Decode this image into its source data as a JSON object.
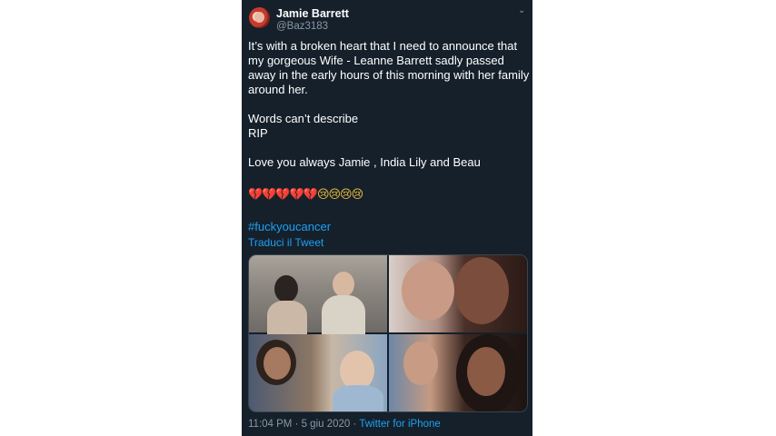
{
  "author": {
    "name": "Jamie Barrett",
    "handle": "@Baz3183"
  },
  "caret_icon": "chevron-down-icon",
  "tweet": {
    "paragraph1": "It’s with a broken heart that I need to announce that my gorgeous Wife - Leanne Barrett sadly passed away in the early hours of this morning with her family around her.",
    "paragraph2_line1": "Words can’t describe",
    "paragraph2_line2": "RIP",
    "paragraph3": "Love you always Jamie , India Lily and Beau",
    "emoji_hearts": "💔💔💔💔💔",
    "emoji_faces": "😢😢😢😢",
    "hashtag": "#fuckyoucancer",
    "translate": "Traduci il Tweet"
  },
  "footer": {
    "timestamp": "11:04 PM · 5 giu 2020 · ",
    "source": "Twitter for iPhone"
  },
  "colors": {
    "background": "#15202b",
    "link": "#1da1f2",
    "muted": "#8899a6"
  }
}
